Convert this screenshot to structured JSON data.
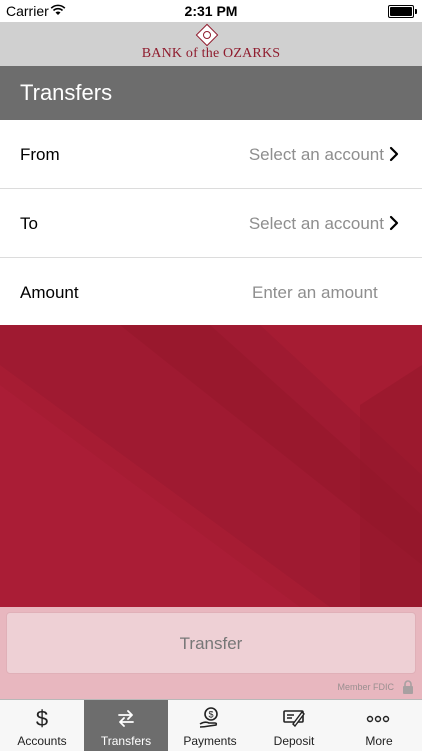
{
  "status_bar": {
    "carrier": "Carrier",
    "time": "2:31 PM"
  },
  "brand": {
    "logo_text": "BANK of the OZARKS"
  },
  "header": {
    "title": "Transfers"
  },
  "form": {
    "from": {
      "label": "From",
      "value": "Select an account"
    },
    "to": {
      "label": "To",
      "value": "Select an account"
    },
    "amount": {
      "label": "Amount",
      "placeholder": "Enter an amount"
    }
  },
  "transfer_button": {
    "label": "Transfer"
  },
  "footer": {
    "fdic": "Member FDIC"
  },
  "tabs": [
    {
      "label": "Accounts",
      "icon": "dollar-icon",
      "active": false
    },
    {
      "label": "Transfers",
      "icon": "transfer-arrows-icon",
      "active": true
    },
    {
      "label": "Payments",
      "icon": "hand-dollar-icon",
      "active": false
    },
    {
      "label": "Deposit",
      "icon": "check-deposit-icon",
      "active": false
    },
    {
      "label": "More",
      "icon": "more-dots-icon",
      "active": false
    }
  ],
  "colors": {
    "brand_red": "#a61c33",
    "header_gray": "#6d6d6d",
    "brand_bar_gray": "#d0d0d0",
    "button_pink": "#eed0d5"
  }
}
